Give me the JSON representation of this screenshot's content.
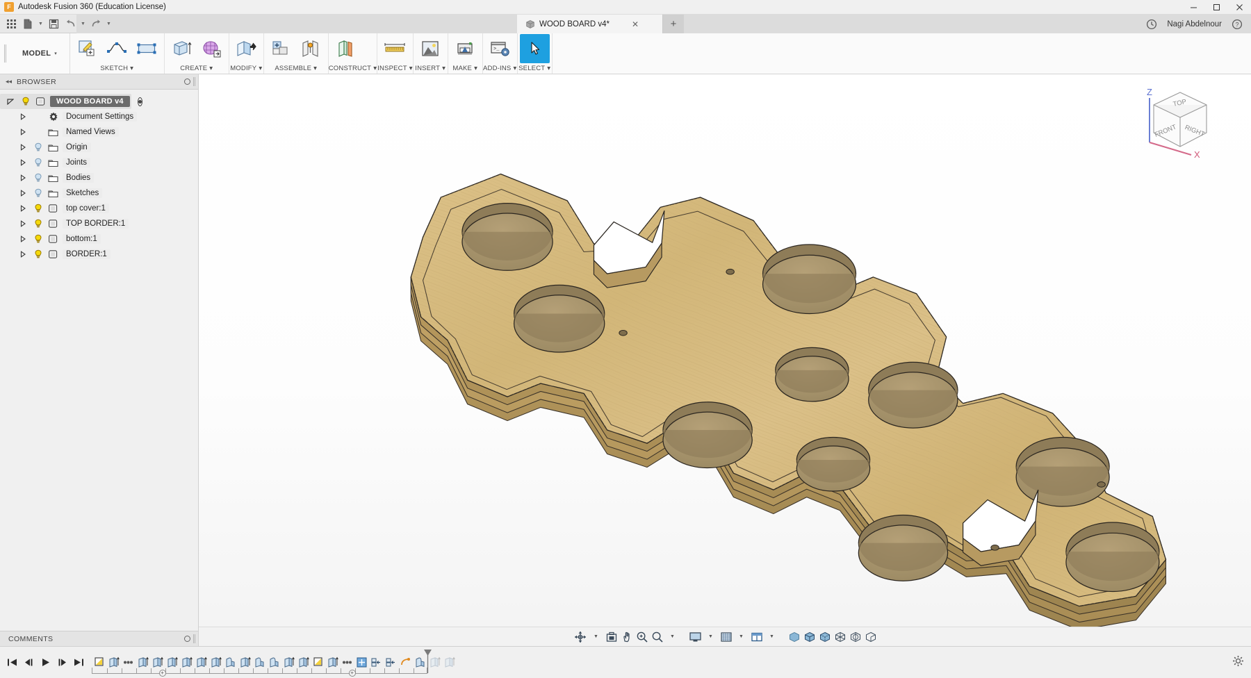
{
  "window": {
    "app_title": "Autodesk Fusion 360 (Education License)",
    "logo_letter": "F",
    "minimize": "─",
    "maximize": "□",
    "close": "✕"
  },
  "quick_access": {
    "buttons": [
      {
        "name": "app-grid-icon",
        "label": "Show Data Panel"
      },
      {
        "name": "new-file-icon",
        "label": "File"
      },
      {
        "name": "save-icon",
        "label": "Save"
      },
      {
        "name": "undo-icon",
        "label": "Undo"
      },
      {
        "name": "redo-icon",
        "label": "Redo"
      }
    ]
  },
  "tabs": {
    "document": {
      "label": "WOOD BOARD v4*",
      "close": "✕"
    },
    "new_tab": "+",
    "user": "Nagi Abdelnour",
    "job_status_icon": "clock-icon",
    "help_icon": "help-icon"
  },
  "workspace": {
    "label": "MODEL",
    "caret": "▾"
  },
  "ribbon": {
    "groups": [
      {
        "label": "SKETCH",
        "caret": "▾",
        "tools": [
          "create-sketch-icon",
          "spline-icon",
          "rectangle-icon"
        ]
      },
      {
        "label": "CREATE",
        "caret": "▾",
        "tools": [
          "extrude-icon",
          "form-icon"
        ]
      },
      {
        "label": "MODIFY",
        "caret": "▾",
        "tools": [
          "press-pull-icon"
        ]
      },
      {
        "label": "ASSEMBLE",
        "caret": "▾",
        "tools": [
          "new-component-icon",
          "joint-icon"
        ]
      },
      {
        "label": "CONSTRUCT",
        "caret": "▾",
        "tools": [
          "offset-plane-icon"
        ]
      },
      {
        "label": "INSPECT",
        "caret": "▾",
        "tools": [
          "measure-icon"
        ]
      },
      {
        "label": "INSERT",
        "caret": "▾",
        "tools": [
          "insert-canvas-icon"
        ]
      },
      {
        "label": "MAKE",
        "caret": "▾",
        "tools": [
          "3d-print-icon"
        ]
      },
      {
        "label": "ADD-INS",
        "caret": "▾",
        "tools": [
          "scripts-addins-icon"
        ]
      },
      {
        "label": "SELECT",
        "caret": "▾",
        "tools": [
          "select-cursor-icon"
        ],
        "active_index": 0
      }
    ]
  },
  "browser": {
    "panel_title": "BROWSER",
    "collapse_icon": "◂◂",
    "tree": [
      {
        "label": "WOOD BOARD v4",
        "depth": 0,
        "arrow": "down",
        "icon": "component-icon",
        "bulb": "on",
        "root": true,
        "eye": true
      },
      {
        "label": "Document Settings",
        "depth": 1,
        "arrow": "right",
        "icon": "gear-icon",
        "bulb": "none"
      },
      {
        "label": "Named Views",
        "depth": 1,
        "arrow": "right",
        "icon": "folder-icon",
        "bulb": "none"
      },
      {
        "label": "Origin",
        "depth": 1,
        "arrow": "right",
        "icon": "folder-icon",
        "bulb": "off"
      },
      {
        "label": "Joints",
        "depth": 1,
        "arrow": "right",
        "icon": "folder-icon",
        "bulb": "off"
      },
      {
        "label": "Bodies",
        "depth": 1,
        "arrow": "right",
        "icon": "folder-icon",
        "bulb": "off"
      },
      {
        "label": "Sketches",
        "depth": 1,
        "arrow": "right",
        "icon": "folder-icon",
        "bulb": "off"
      },
      {
        "label": "top cover:1",
        "depth": 1,
        "arrow": "right",
        "icon": "component-icon",
        "bulb": "on"
      },
      {
        "label": "TOP BORDER:1",
        "depth": 1,
        "arrow": "right",
        "icon": "component-icon",
        "bulb": "on"
      },
      {
        "label": "bottom:1",
        "depth": 1,
        "arrow": "right",
        "icon": "component-icon",
        "bulb": "on"
      },
      {
        "label": "BORDER:1",
        "depth": 1,
        "arrow": "right",
        "icon": "component-icon",
        "bulb": "on"
      }
    ]
  },
  "comments": {
    "title": "COMMENTS"
  },
  "viewcube": {
    "top": "TOP",
    "front": "FRONT",
    "right": "RIGHT",
    "axis_z": "Z",
    "axis_x": "X"
  },
  "navbar": {
    "items": [
      {
        "name": "orbit-icon",
        "caret": true
      },
      {
        "name": "look-at-icon",
        "caret": false
      },
      {
        "name": "pan-icon",
        "caret": false
      },
      {
        "name": "zoom-icon",
        "caret": false
      },
      {
        "name": "zoom-window-icon",
        "caret": true
      },
      {
        "name": "display-settings-icon",
        "caret": true
      },
      {
        "name": "grid-snap-icon",
        "caret": true
      },
      {
        "name": "viewports-icon",
        "caret": true
      },
      {
        "name": "shaded-icon",
        "caret": false
      },
      {
        "name": "shaded-hidden-edges-icon",
        "caret": false
      },
      {
        "name": "shaded-visible-edges-icon",
        "caret": false
      },
      {
        "name": "wireframe-icon",
        "caret": false
      },
      {
        "name": "wireframe-hidden-icon",
        "caret": false
      },
      {
        "name": "wireframe-visible-icon",
        "caret": false
      }
    ]
  },
  "timeline": {
    "playback": [
      {
        "name": "go-to-beginning-button",
        "glyph": "❘◀"
      },
      {
        "name": "step-back-button",
        "glyph": "◀❘"
      },
      {
        "name": "play-button",
        "glyph": "▶"
      },
      {
        "name": "step-forward-button",
        "glyph": "❘▶"
      },
      {
        "name": "go-to-end-button",
        "glyph": "▶❘"
      }
    ],
    "features": [
      "sketch-icon",
      "extrude-icon",
      "hole-icon",
      "extrude-icon",
      "extrude-icon",
      "extrude-icon",
      "extrude-icon",
      "extrude-icon",
      "extrude-icon",
      "fillet-icon",
      "extrude-icon",
      "fillet-icon",
      "fillet-icon",
      "extrude-icon",
      "extrude-icon",
      "sketch-icon",
      "extrude-icon",
      "hole-icon",
      "move-icon",
      "align-icon",
      "align-icon",
      "joint-icon",
      "fillet-icon"
    ],
    "ghost_features": [
      "extrude-icon",
      "extrude-icon"
    ],
    "settings_icon": "gear-icon"
  },
  "colors": {
    "accent": "#1ea0e0",
    "wood_top": "#d7bb7f",
    "wood_side": "#b99b62",
    "wood_hole": "#a58d62",
    "chrome": "#f0f0f0",
    "tab_active": "#f4f4f4",
    "tree_select": "#6b6b6b"
  }
}
